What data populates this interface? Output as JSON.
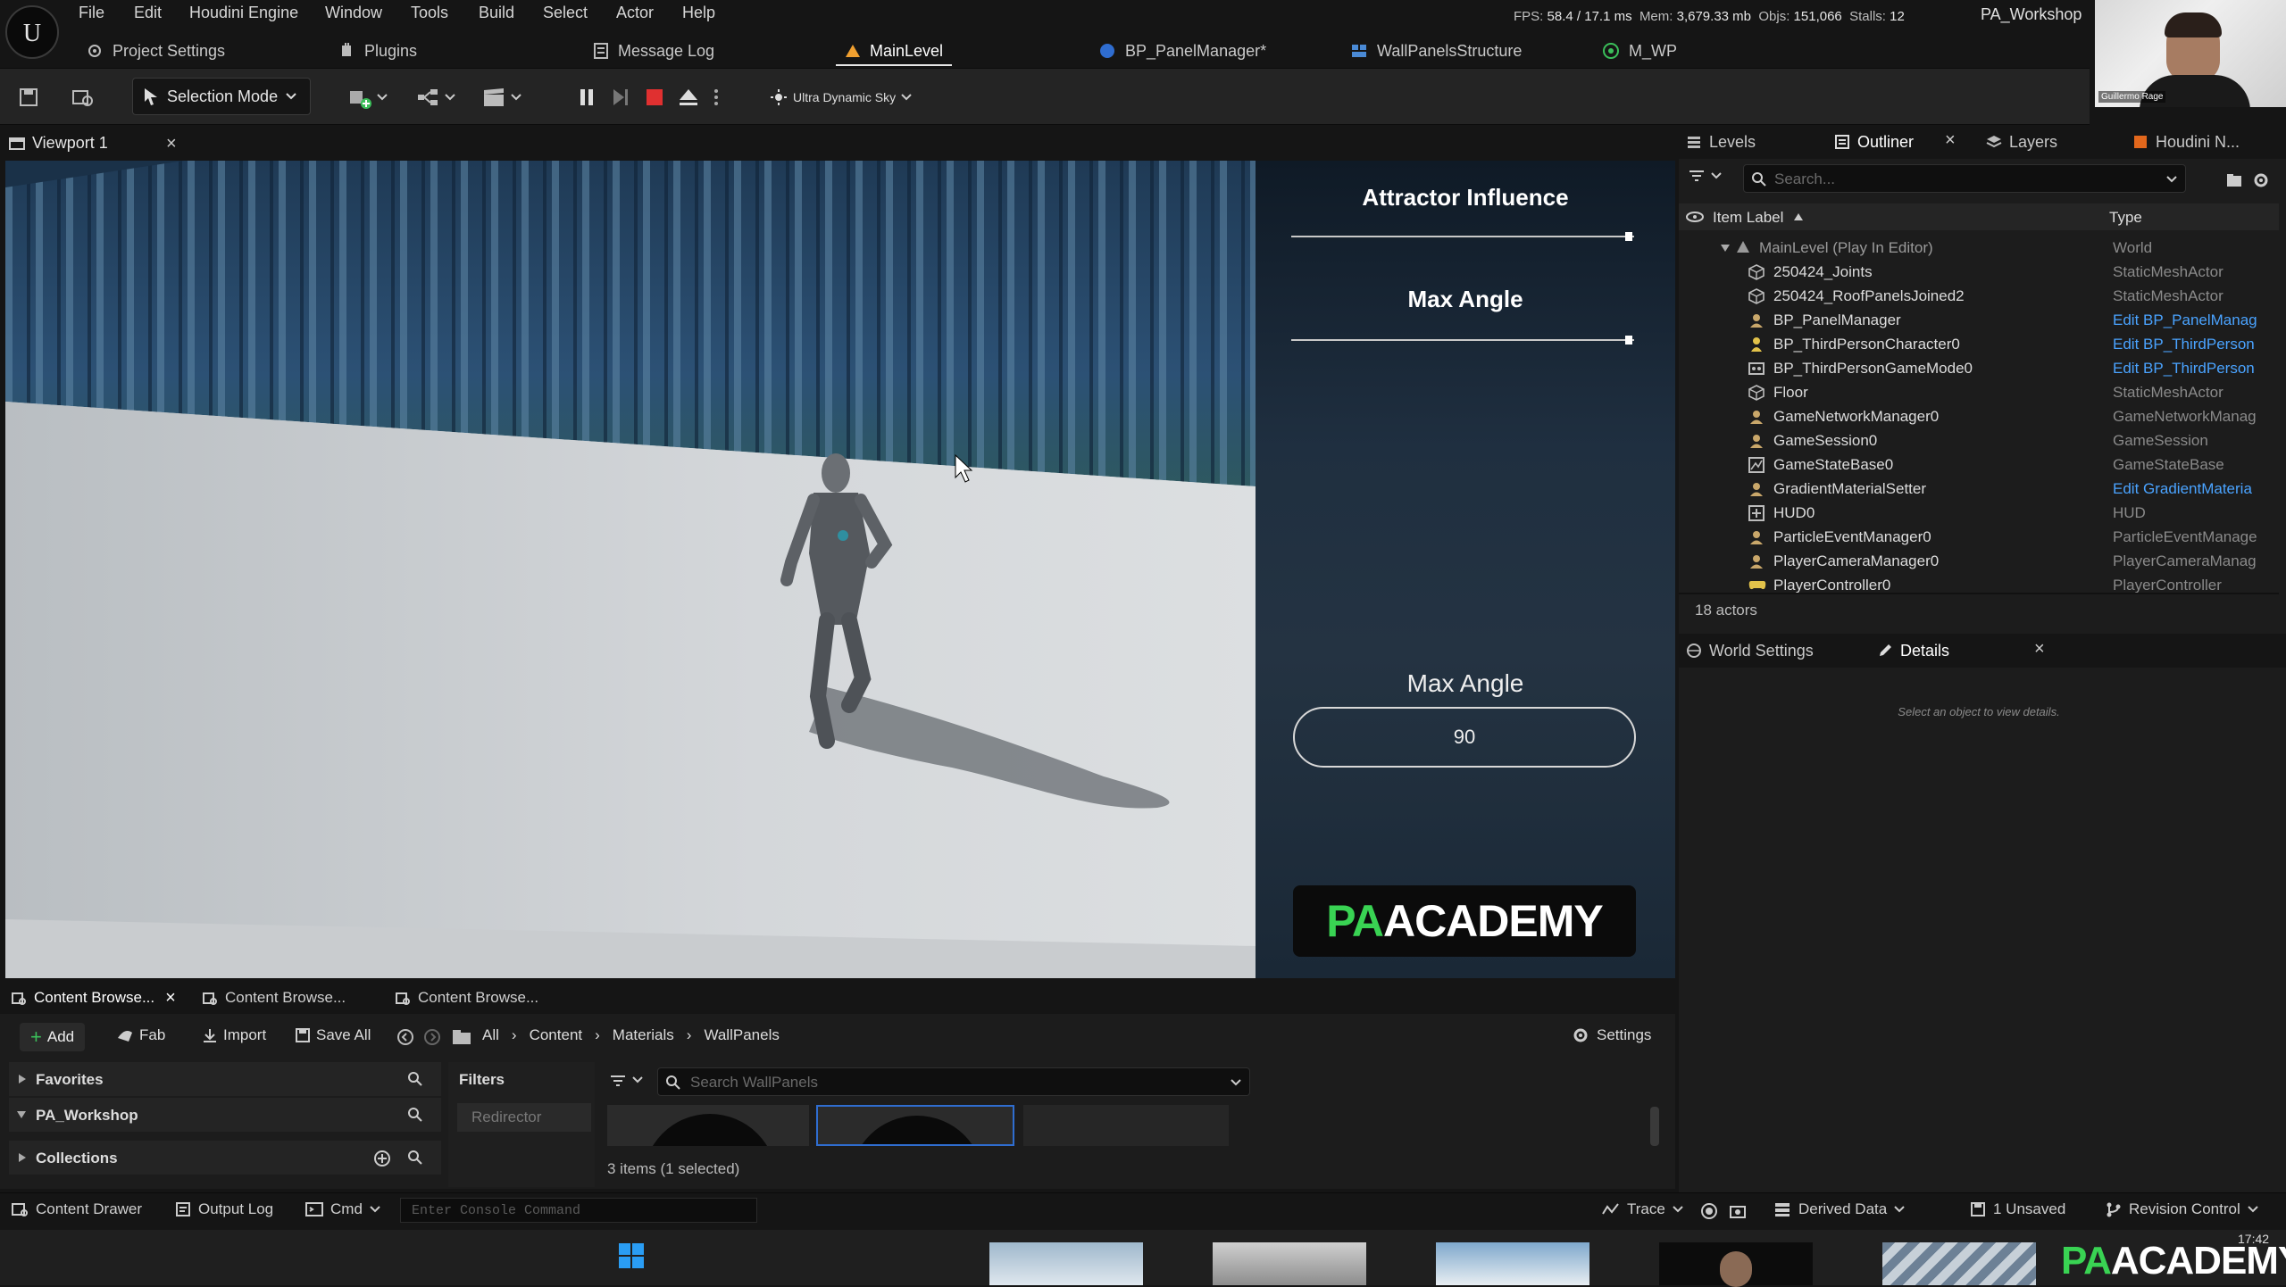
{
  "menu": [
    "File",
    "Edit",
    "Houdini Engine",
    "Window",
    "Tools",
    "Build",
    "Select",
    "Actor",
    "Help"
  ],
  "stats": {
    "fps_label": "FPS:",
    "fps": "58.4",
    "ms": "/ 17.1 ms",
    "mem_label": "Mem:",
    "mem": "3,679.33 mb",
    "objs_label": "Objs:",
    "objs": "151,066",
    "stalls_label": "Stalls:",
    "stalls": "12"
  },
  "project_name": "PA_Workshop",
  "webcam_name": "Guillermo Rage",
  "tabs": [
    "Project Settings",
    "Plugins",
    "Message Log",
    "MainLevel",
    "BP_PanelManager*",
    "WallPanelsStructure",
    "M_WP"
  ],
  "toolbar": {
    "selection_mode": "Selection Mode",
    "sky": "Ultra Dynamic Sky"
  },
  "viewport": {
    "tab": "Viewport 1"
  },
  "hud": {
    "attractor_label": "Attractor Influence",
    "attractor_value": 1.0,
    "max_angle_label": "Max Angle",
    "max_angle_slider_value": 1.0,
    "max_angle_input_label": "Max Angle",
    "max_angle_input_value": "90",
    "logo_pa": "PA",
    "logo_academy": "ACADEMY"
  },
  "right_tabs": [
    "Levels",
    "Outliner",
    "Layers",
    "Houdini N..."
  ],
  "outliner": {
    "search_placeholder": "Search...",
    "col_label": "Item Label",
    "col_type": "Type",
    "root": {
      "label": "MainLevel (Play In Editor)",
      "type": "World"
    },
    "rows": [
      {
        "label": "250424_Joints",
        "type": "StaticMeshActor",
        "link": false,
        "icon": "static-mesh-icon"
      },
      {
        "label": "250424_RoofPanelsJoined2",
        "type": "StaticMeshActor",
        "link": false,
        "icon": "static-mesh-icon"
      },
      {
        "label": "BP_PanelManager",
        "type": "Edit BP_PanelManag",
        "link": true,
        "icon": "actor-icon"
      },
      {
        "label": "BP_ThirdPersonCharacter0",
        "type": "Edit BP_ThirdPerson",
        "link": true,
        "icon": "pawn-icon"
      },
      {
        "label": "BP_ThirdPersonGameMode0",
        "type": "Edit BP_ThirdPerson",
        "link": true,
        "icon": "gamemode-icon"
      },
      {
        "label": "Floor",
        "type": "StaticMeshActor",
        "link": false,
        "icon": "static-mesh-icon"
      },
      {
        "label": "GameNetworkManager0",
        "type": "GameNetworkManag",
        "link": false,
        "icon": "actor-icon"
      },
      {
        "label": "GameSession0",
        "type": "GameSession",
        "link": false,
        "icon": "actor-icon"
      },
      {
        "label": "GameStateBase0",
        "type": "GameStateBase",
        "link": false,
        "icon": "gamestate-icon"
      },
      {
        "label": "GradientMaterialSetter",
        "type": "Edit GradientMateria",
        "link": true,
        "icon": "actor-icon"
      },
      {
        "label": "HUD0",
        "type": "HUD",
        "link": false,
        "icon": "hud-icon"
      },
      {
        "label": "ParticleEventManager0",
        "type": "ParticleEventManage",
        "link": false,
        "icon": "actor-icon"
      },
      {
        "label": "PlayerCameraManager0",
        "type": "PlayerCameraManag",
        "link": false,
        "icon": "actor-icon"
      },
      {
        "label": "PlayerController0",
        "type": "PlayerController",
        "link": false,
        "icon": "controller-icon"
      }
    ],
    "count": "18 actors"
  },
  "details": {
    "tab1": "World Settings",
    "tab2": "Details",
    "empty_msg": "Select an object to view details."
  },
  "content_browser": {
    "tabs": [
      "Content Browse...",
      "Content Browse...",
      "Content Browse..."
    ],
    "add": "Add",
    "fab": "Fab",
    "import": "Import",
    "save_all": "Save All",
    "path": [
      "All",
      "Content",
      "Materials",
      "WallPanels"
    ],
    "settings": "Settings",
    "favorites": "Favorites",
    "project": "PA_Workshop",
    "collections": "Collections",
    "filters": "Filters",
    "redirector": "Redirector",
    "search_placeholder": "Search WallPanels",
    "count": "3 items (1 selected)"
  },
  "statusbar": {
    "content_drawer": "Content Drawer",
    "output_log": "Output Log",
    "cmd": "Cmd",
    "console_placeholder": "Enter Console Command",
    "trace": "Trace",
    "derived_data": "Derived Data",
    "unsaved": "1 Unsaved",
    "revision": "Revision Control"
  },
  "taskbar": {
    "logo_pa": "PA",
    "logo_academy": "ACADEMY",
    "time": "17:42"
  }
}
